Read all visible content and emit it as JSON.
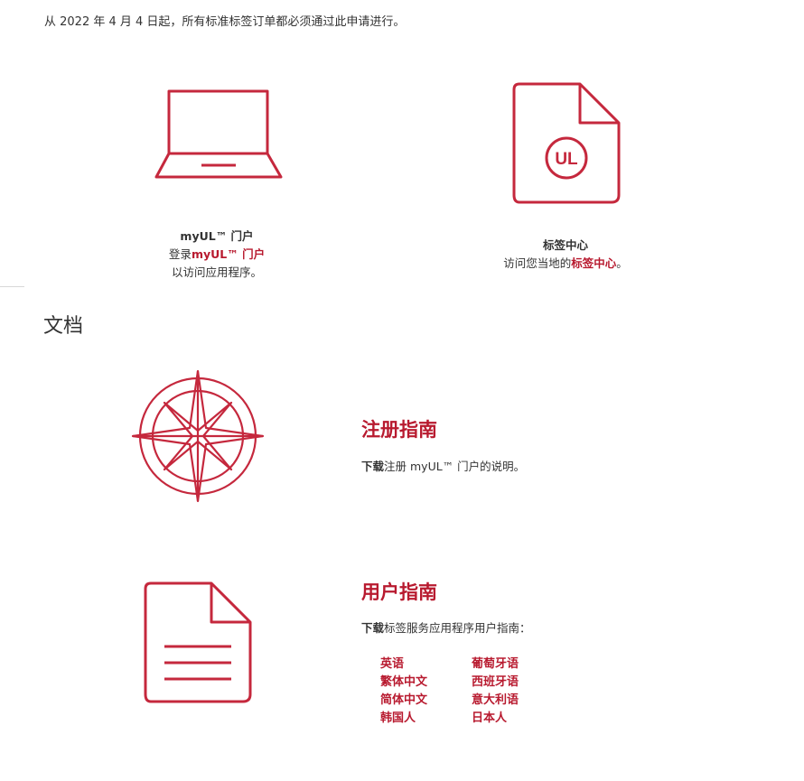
{
  "notice": "从 2022 年 4 月 4 日起，所有标准标签订单都必须通过此申请进行。",
  "myul_card": {
    "icon": "laptop-icon",
    "title": "myUL™ 门户",
    "login_prefix": "登录",
    "login_link": "myUL™ 门户",
    "subtext": "以访问应用程序。"
  },
  "label_center_card": {
    "icon": "ul-document-icon",
    "title": "标签中心",
    "visit_prefix": "访问您当地的",
    "visit_link": "标签中心",
    "visit_suffix": "。"
  },
  "documents": {
    "heading": "文档",
    "registration": {
      "icon": "compass-icon",
      "title": "注册指南",
      "download": "下载",
      "desc": "注册 myUL™ 门户的说明。"
    },
    "user_guide": {
      "icon": "document-icon",
      "title": "用户指南",
      "download": "下载",
      "desc": "标签服务应用程序用户指南：",
      "languages_left": [
        "英语",
        "繁体中文",
        "简体中文",
        "韩国人"
      ],
      "languages_right": [
        "葡萄牙语",
        "西班牙语",
        "意大利语",
        "日本人"
      ]
    }
  },
  "colors": {
    "accent": "#b81a2f",
    "icon_stroke": "#c5283d",
    "text": "#333333"
  }
}
